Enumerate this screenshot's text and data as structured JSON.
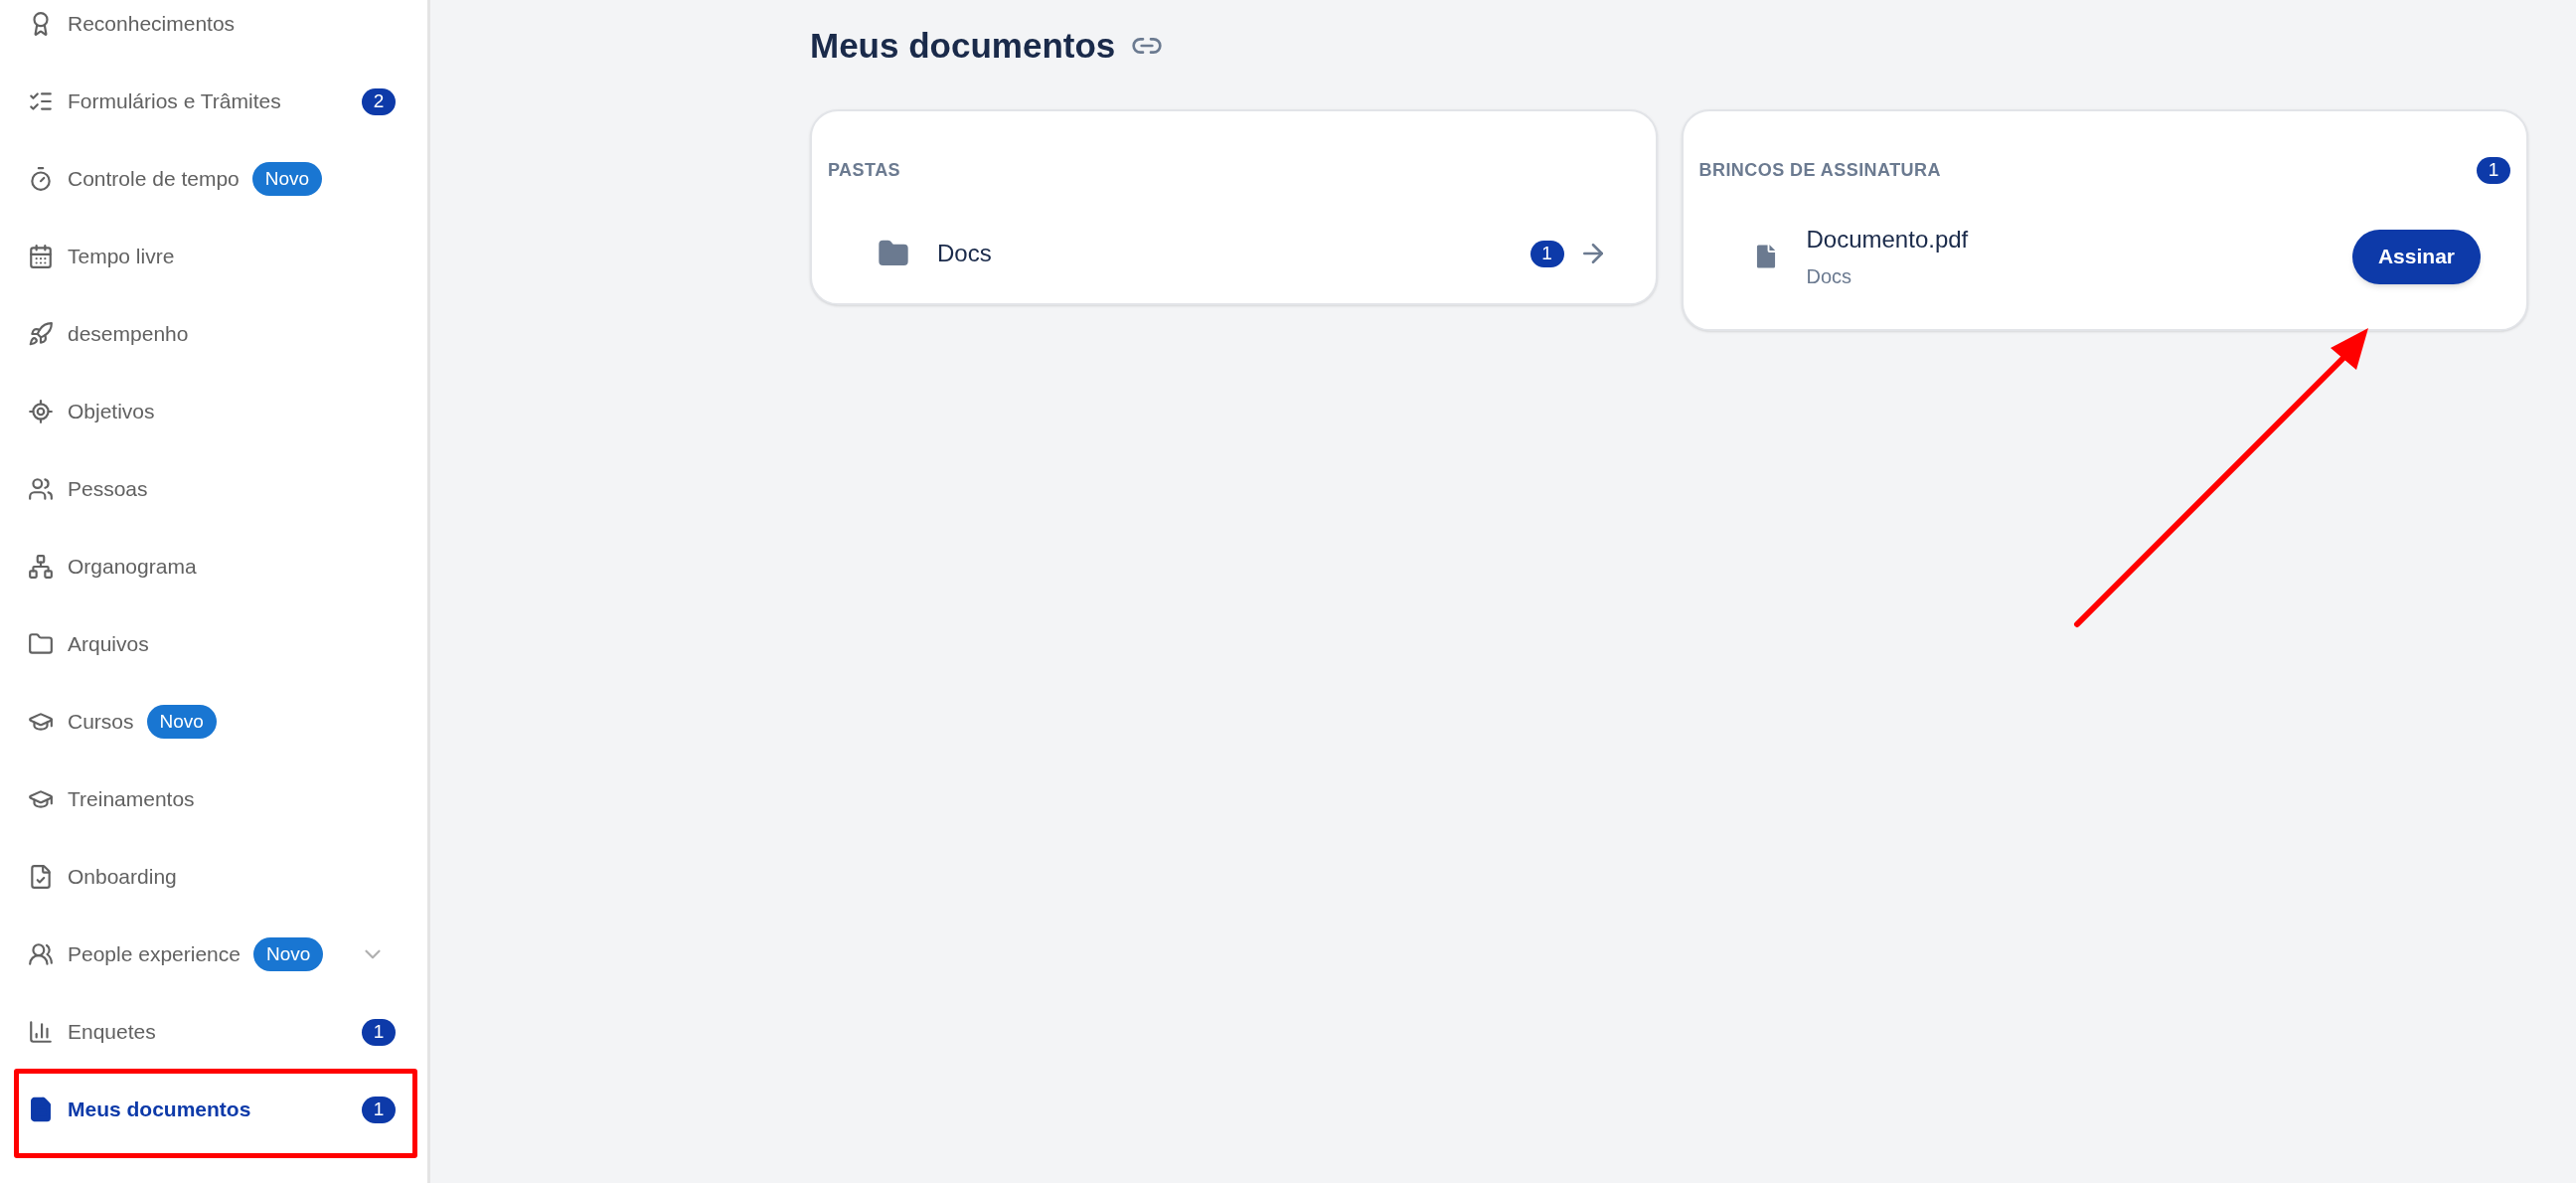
{
  "sidebar": {
    "items": [
      {
        "label": "Reconhecimentos",
        "selected": false
      },
      {
        "label": "Formulários e Trâmites",
        "selected": false,
        "count": "2"
      },
      {
        "label": "Controle de tempo",
        "selected": false,
        "tag": "Novo"
      },
      {
        "label": "Tempo livre",
        "selected": false
      },
      {
        "label": "desempenho",
        "selected": false
      },
      {
        "label": "Objetivos",
        "selected": false
      },
      {
        "label": "Pessoas",
        "selected": false
      },
      {
        "label": "Organograma",
        "selected": false
      },
      {
        "label": "Arquivos",
        "selected": false
      },
      {
        "label": "Cursos",
        "selected": false,
        "tag": "Novo"
      },
      {
        "label": "Treinamentos",
        "selected": false
      },
      {
        "label": "Onboarding",
        "selected": false
      },
      {
        "label": "People experience",
        "selected": false,
        "tag": "Novo",
        "expanded": false
      },
      {
        "label": "Enquetes",
        "selected": false,
        "count": "1"
      },
      {
        "label": "Meus documentos",
        "selected": true,
        "count": "1"
      }
    ]
  },
  "page": {
    "title": "Meus documentos"
  },
  "folders_card": {
    "heading": "PASTAS",
    "items": [
      {
        "name": "Docs",
        "count": "1"
      }
    ]
  },
  "signature_card": {
    "heading": "BRINCOS DE ASSINATURA",
    "count": "1",
    "items": [
      {
        "name": "Documento.pdf",
        "folder": "Docs",
        "action": "Assinar"
      }
    ]
  }
}
